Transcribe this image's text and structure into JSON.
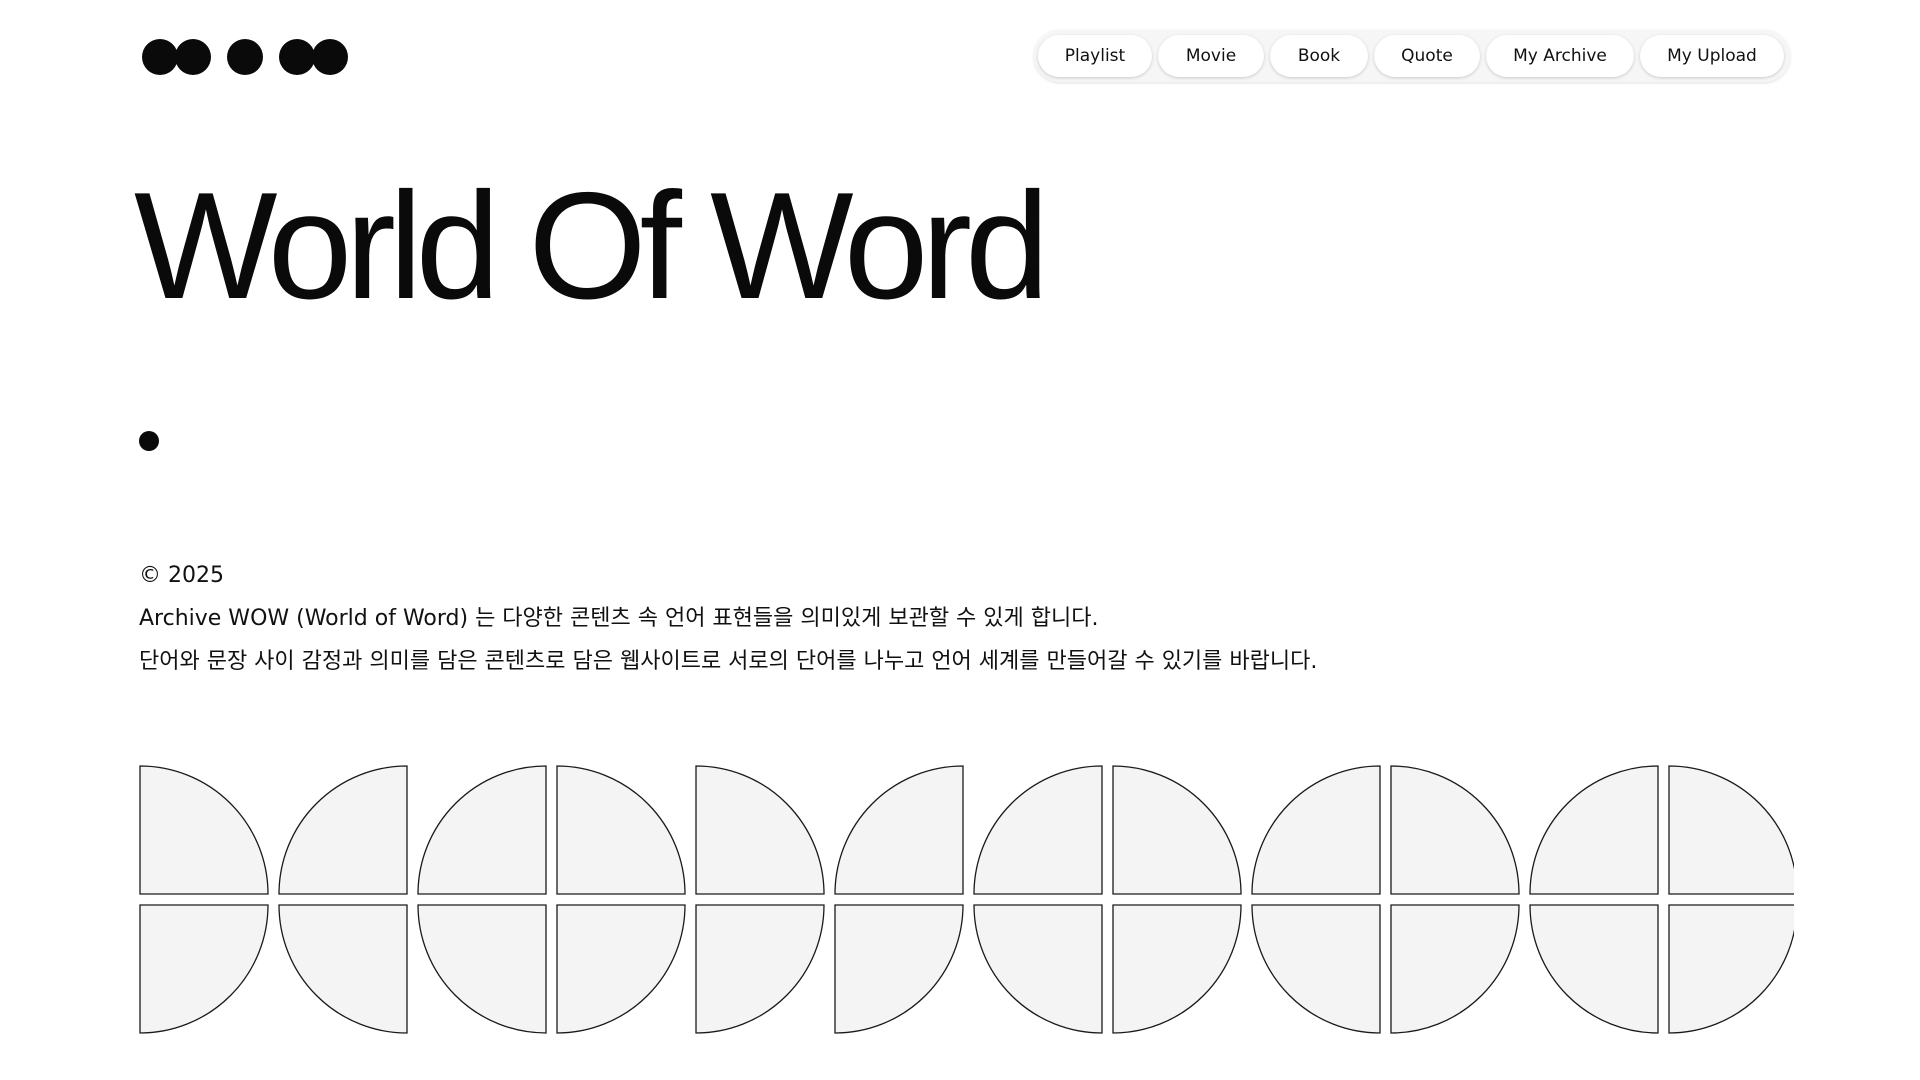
{
  "nav": {
    "items": [
      {
        "label": "Playlist"
      },
      {
        "label": "Movie"
      },
      {
        "label": "Book"
      },
      {
        "label": "Quote"
      },
      {
        "label": "My Archive"
      },
      {
        "label": "My Upload"
      }
    ]
  },
  "hero": {
    "title": "World Of Word"
  },
  "info": {
    "copyright": "© 2025",
    "line1": "Archive WOW (World of Word) 는 다양한 콘텐츠 속 언어 표현들을 의미있게 보관할 수 있게 합니다.",
    "line2": "단어와 문장 사이 감정과 의미를 담은 콘텐츠로 담은 웹사이트로 서로의 단어를 나누고 언어 세계를 만들어갈 수 있기를 바랍니다."
  },
  "colors": {
    "shape_fill": "#f4f4f4",
    "shape_stroke": "#1a1a1a",
    "text": "#111111"
  },
  "pattern": {
    "top_row": [
      "tl",
      "tr",
      "tr",
      "tl",
      "tl",
      "tr",
      "tr",
      "tl",
      "tr",
      "tl",
      "tr",
      "tl"
    ],
    "bottom_row": [
      "bl",
      "br",
      "br",
      "bl",
      "bl",
      "bl",
      "br",
      "bl",
      "br",
      "bl",
      "br",
      "bl"
    ]
  }
}
